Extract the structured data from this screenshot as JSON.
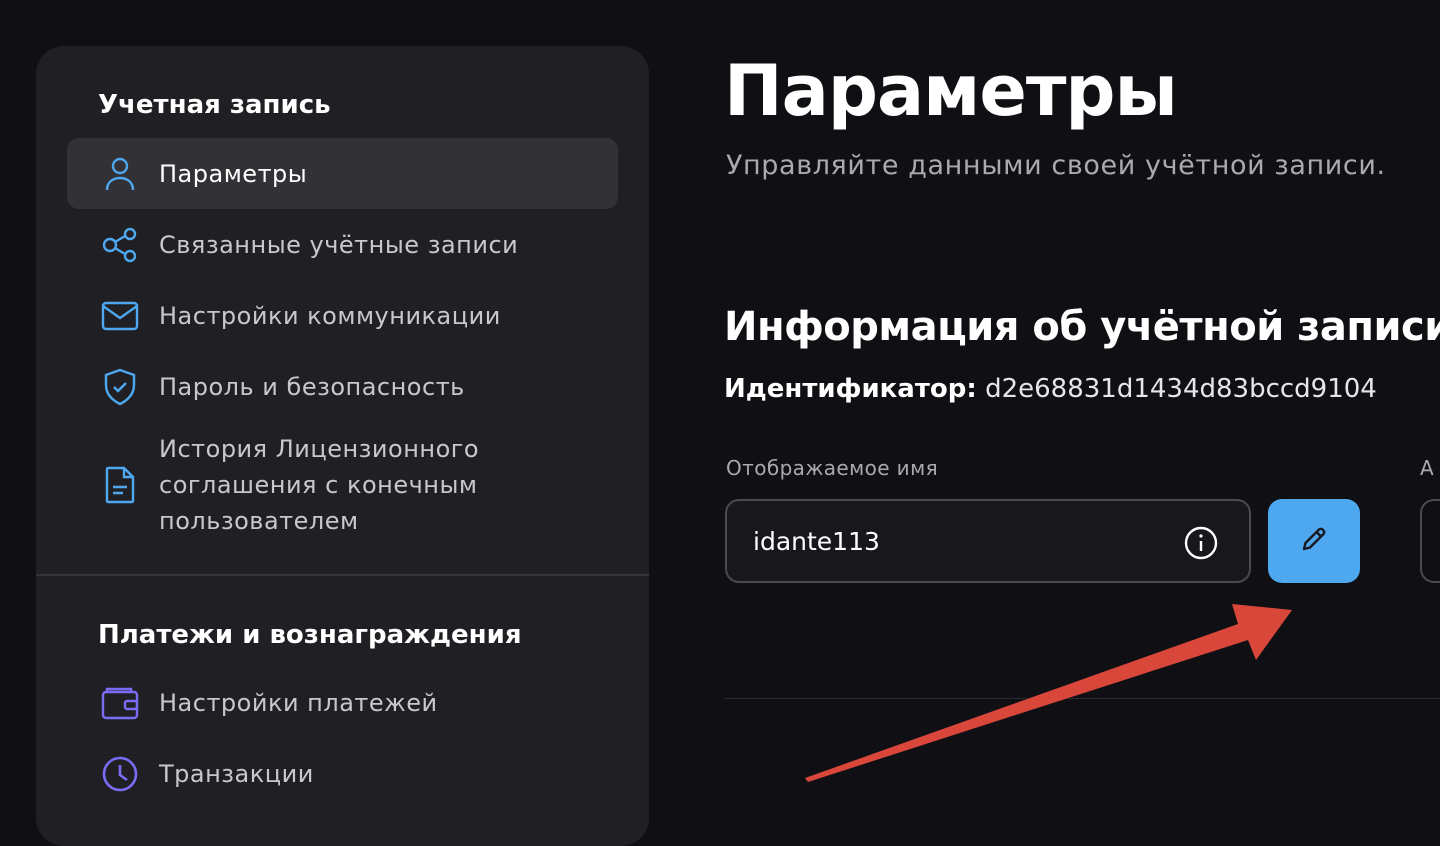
{
  "sidebar": {
    "account_section": "Учетная запись",
    "items": [
      {
        "label": "Параметры",
        "icon": "user-icon",
        "active": true
      },
      {
        "label": "Связанные учётные записи",
        "icon": "share-nodes-icon"
      },
      {
        "label": "Настройки коммуникации",
        "icon": "mail-icon"
      },
      {
        "label": "Пароль и безопасность",
        "icon": "shield-check-icon"
      },
      {
        "label": "История Лицензионного\nсоглашения с конечным\nпользователем",
        "icon": "document-icon"
      }
    ],
    "payments_section": "Платежи и вознаграждения",
    "payment_items": [
      {
        "label": "Настройки платежей",
        "icon": "wallet-icon"
      },
      {
        "label": "Транзакции",
        "icon": "clock-icon"
      }
    ]
  },
  "main": {
    "title": "Параметры",
    "subtitle": "Управляйте данными своей учётной записи.",
    "info_heading": "Информация об учётной записи",
    "id_label": "Идентификатор:",
    "id_value": "d2e68831d1434d83bccd9104",
    "display_name_label": "Отображаемое имя",
    "display_name_value": "idante113",
    "second_field_label": "А"
  },
  "colors": {
    "accent": "#4ea8f0",
    "arrow": "#d9473b",
    "purple_icon": "#7b6cf6"
  }
}
